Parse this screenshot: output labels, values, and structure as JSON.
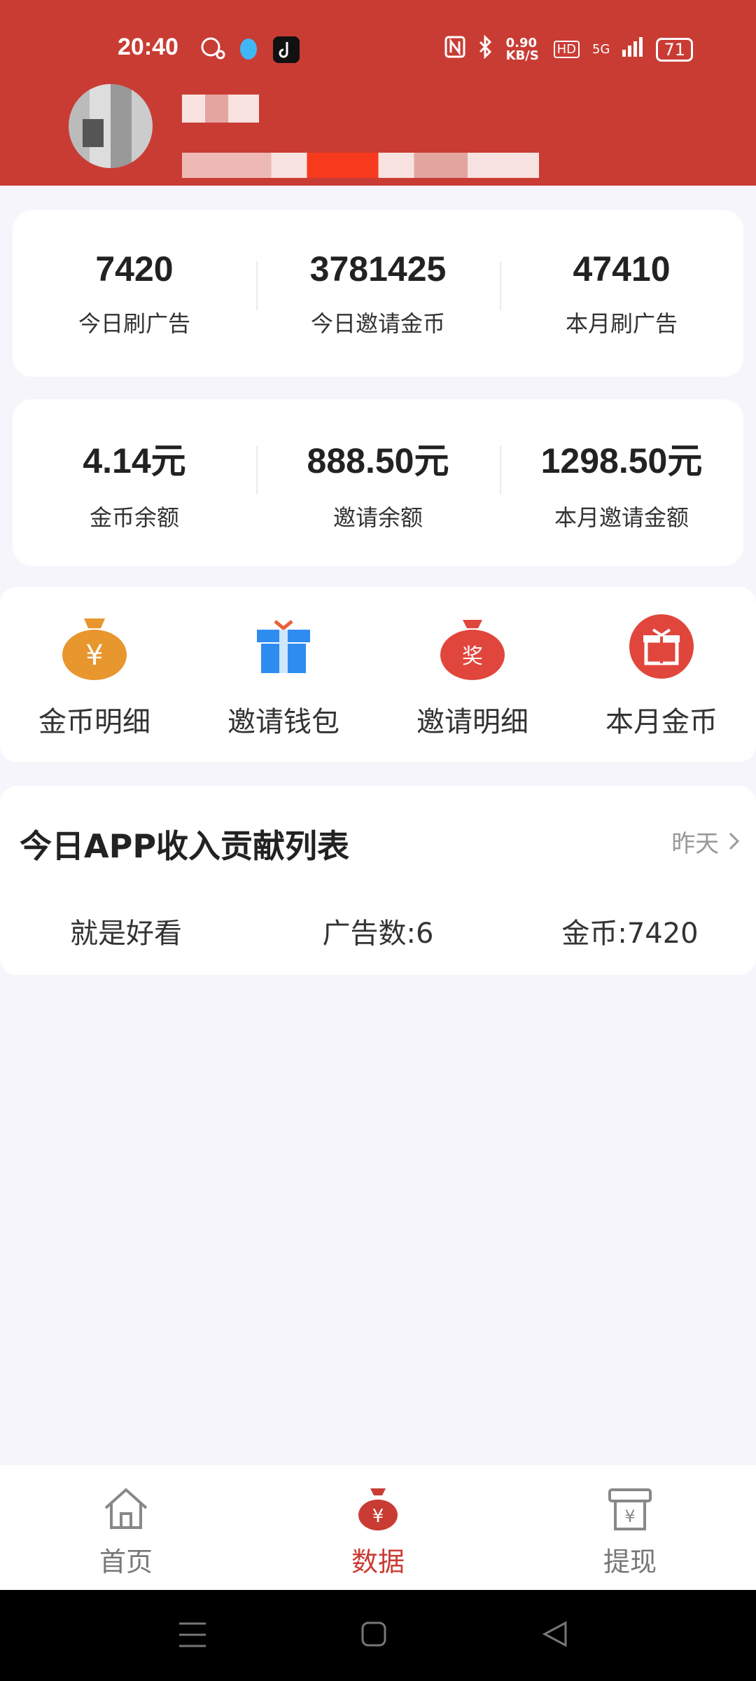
{
  "status": {
    "time": "20:40",
    "net_speed": "0.90 KB/S",
    "hd": "HD",
    "signal": "5G",
    "battery": "71"
  },
  "stats_row1": [
    {
      "value": "7420",
      "label": "今日刷广告"
    },
    {
      "value": "3781425",
      "label": "今日邀请金币"
    },
    {
      "value": "47410",
      "label": "本月刷广告"
    }
  ],
  "stats_row2": [
    {
      "value": "4.14元",
      "label": "金币余额"
    },
    {
      "value": "888.50元",
      "label": "邀请余额"
    },
    {
      "value": "1298.50元",
      "label": "本月邀请金额"
    }
  ],
  "shortcuts": [
    {
      "label": "金币明细",
      "icon": "money-bag-yen-icon"
    },
    {
      "label": "邀请钱包",
      "icon": "gift-box-icon"
    },
    {
      "label": "邀请明细",
      "icon": "reward-bag-icon"
    },
    {
      "label": "本月金币",
      "icon": "gift-circle-icon"
    }
  ],
  "contrib": {
    "title": "今日APP收入贡献列表",
    "more": "昨天",
    "rows": [
      {
        "app": "就是好看",
        "ads": "广告数:6",
        "coins": "金币:7420"
      }
    ]
  },
  "tabs": [
    {
      "label": "首页",
      "icon": "home-icon"
    },
    {
      "label": "数据",
      "icon": "money-bag-icon"
    },
    {
      "label": "提现",
      "icon": "withdraw-icon"
    }
  ],
  "colors": {
    "brand": "#c93c34",
    "orange": "#e8962e",
    "blue": "#2e8cf0"
  }
}
